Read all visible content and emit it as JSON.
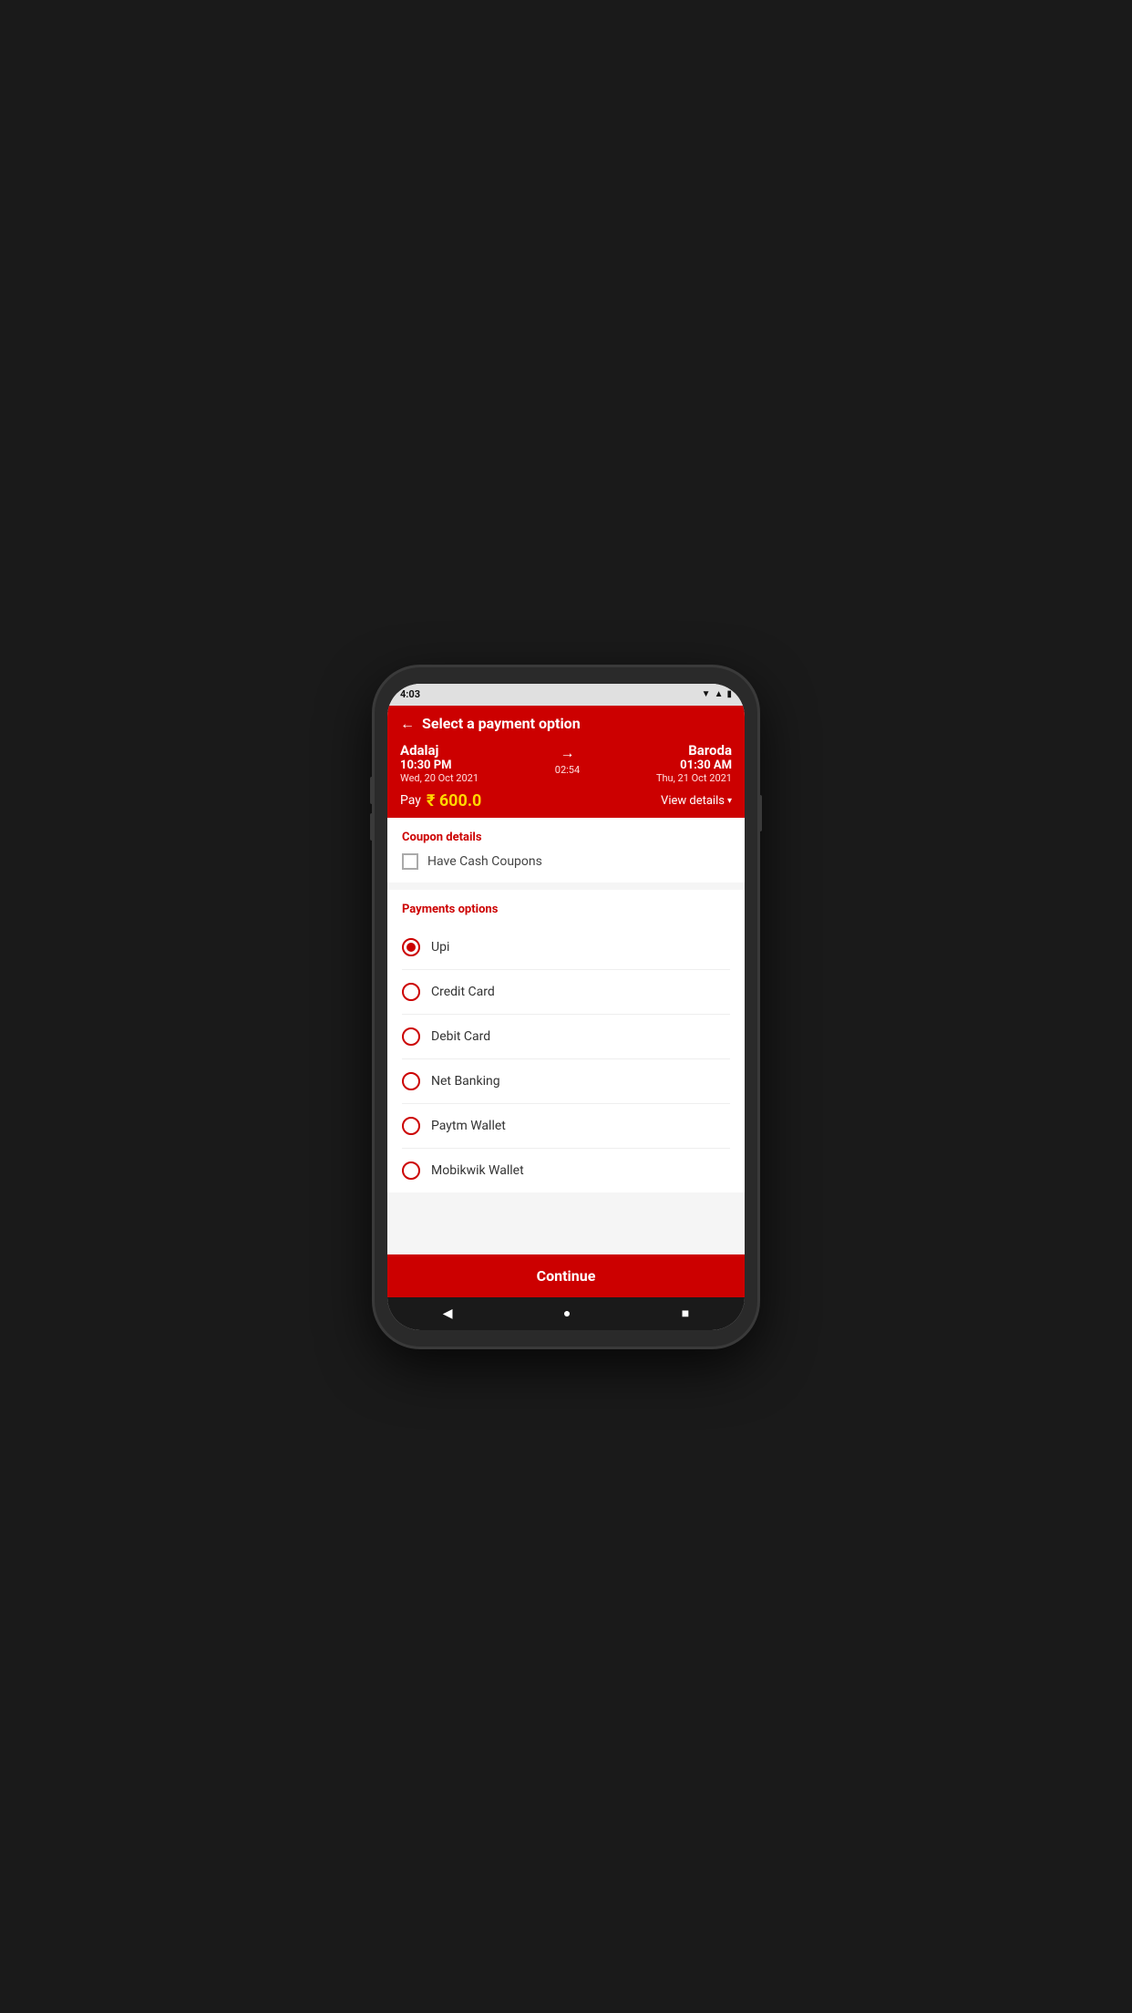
{
  "status_bar": {
    "time": "4:03",
    "icons": "▼ ▲ 4 🔋"
  },
  "header": {
    "back_label": "←",
    "title": "Select a payment option",
    "origin_city": "Adalaj",
    "origin_time": "10:30 PM",
    "origin_date": "Wed, 20 Oct 2021",
    "duration": "02:54",
    "dest_city": "Baroda",
    "dest_time": "01:30 AM",
    "dest_date": "Thu, 21 Oct 2021",
    "pay_label": "Pay",
    "pay_amount": "₹ 600.0",
    "view_details_label": "View details",
    "chevron": "▾"
  },
  "coupon_section": {
    "title": "Coupon details",
    "checkbox_label": "Have Cash Coupons"
  },
  "payments_section": {
    "title": "Payments options",
    "options": [
      {
        "label": "Upi",
        "selected": true
      },
      {
        "label": "Credit Card",
        "selected": false
      },
      {
        "label": "Debit Card",
        "selected": false
      },
      {
        "label": "Net Banking",
        "selected": false
      },
      {
        "label": "Paytm Wallet",
        "selected": false
      },
      {
        "label": "Mobikwik Wallet",
        "selected": false
      }
    ]
  },
  "continue_btn": {
    "label": "Continue"
  },
  "nav_bar": {
    "back": "◀",
    "home": "●",
    "square": "■"
  }
}
